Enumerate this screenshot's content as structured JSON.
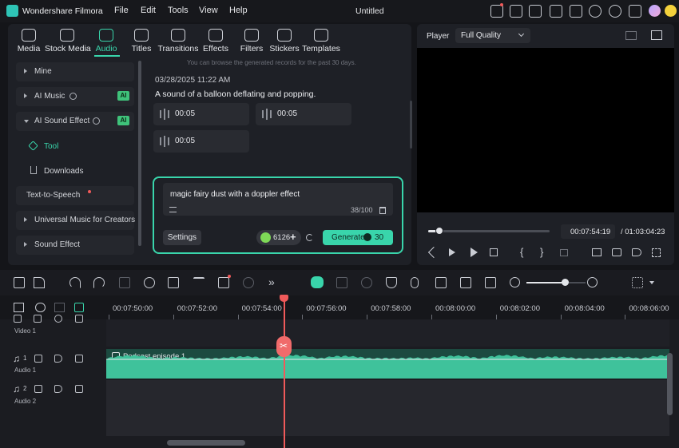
{
  "app": {
    "name": "Wondershare Filmora",
    "doc_title": "Untitled"
  },
  "menu": [
    "File",
    "Edit",
    "Tools",
    "View",
    "Help"
  ],
  "media_tabs": [
    {
      "label": "Media",
      "icon": "media-icon"
    },
    {
      "label": "Stock Media",
      "icon": "stock-media-icon"
    },
    {
      "label": "Audio",
      "icon": "music-note-icon",
      "active": true
    },
    {
      "label": "Titles",
      "icon": "titles-icon"
    },
    {
      "label": "Transitions",
      "icon": "transitions-icon"
    },
    {
      "label": "Effects",
      "icon": "effects-icon"
    },
    {
      "label": "Filters",
      "icon": "filters-icon"
    },
    {
      "label": "Stickers",
      "icon": "stickers-icon"
    },
    {
      "label": "Templates",
      "icon": "templates-icon"
    }
  ],
  "sidebar": {
    "mine": "Mine",
    "ai_music": "AI Music",
    "ai_sound_effect": "AI Sound Effect",
    "ai_badge": "AI",
    "tool": "Tool",
    "downloads": "Downloads",
    "text_to_speech": "Text-to-Speech",
    "universal_music": "Universal Music for Creators",
    "sound_effect": "Sound Effect"
  },
  "generated": {
    "notice": "You can browse the generated records for the past 30 days.",
    "timestamp": "03/28/2025 11:22 AM",
    "prompt": "A sound of a balloon deflating and popping.",
    "clips": [
      "00:05",
      "00:05",
      "00:05"
    ]
  },
  "prompt_box": {
    "text": "magic fairy dust with a doppler effect",
    "counter": "38/100",
    "settings_label": "Settings",
    "credits": "6126",
    "generate_label": "Generate",
    "generate_cost": "30"
  },
  "player": {
    "label": "Player",
    "quality": "Full Quality",
    "current_time": "00:07:54:19",
    "total_time": "/ 01:03:04:23",
    "progress": 0.09
  },
  "timeline": {
    "ticks": [
      "00:07:50:00",
      "00:07:52:00",
      "00:07:54:00",
      "00:07:56:00",
      "00:07:58:00",
      "00:08:00:00",
      "00:08:02:00",
      "00:08:04:00",
      "00:08:06:00"
    ],
    "tracks": [
      "Video 1",
      "Audio 1",
      "Audio 2"
    ],
    "track_nums": [
      "1",
      "1",
      "2"
    ],
    "clip_name": "Podcast episode 1",
    "zoom_level": 0.65
  },
  "colors": {
    "accent": "#39d5ab",
    "playhead": "#f05a5a",
    "wave": "#3fc29b"
  }
}
